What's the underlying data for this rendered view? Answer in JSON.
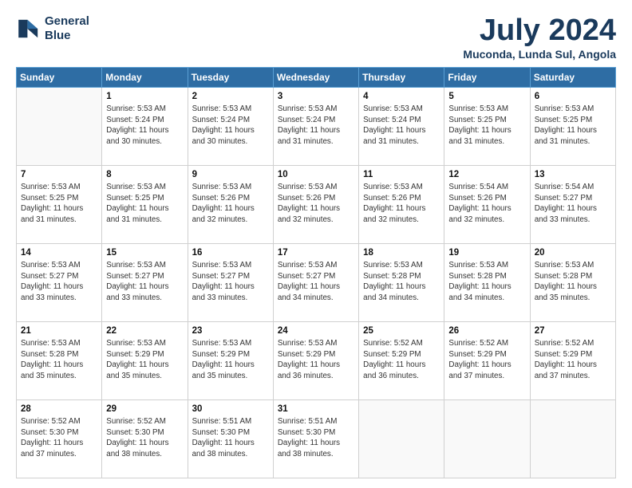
{
  "header": {
    "logo_line1": "General",
    "logo_line2": "Blue",
    "month_title": "July 2024",
    "location": "Muconda, Lunda Sul, Angola"
  },
  "weekdays": [
    "Sunday",
    "Monday",
    "Tuesday",
    "Wednesday",
    "Thursday",
    "Friday",
    "Saturday"
  ],
  "weeks": [
    [
      {
        "day": "",
        "info": ""
      },
      {
        "day": "1",
        "info": "Sunrise: 5:53 AM\nSunset: 5:24 PM\nDaylight: 11 hours\nand 30 minutes."
      },
      {
        "day": "2",
        "info": "Sunrise: 5:53 AM\nSunset: 5:24 PM\nDaylight: 11 hours\nand 30 minutes."
      },
      {
        "day": "3",
        "info": "Sunrise: 5:53 AM\nSunset: 5:24 PM\nDaylight: 11 hours\nand 31 minutes."
      },
      {
        "day": "4",
        "info": "Sunrise: 5:53 AM\nSunset: 5:24 PM\nDaylight: 11 hours\nand 31 minutes."
      },
      {
        "day": "5",
        "info": "Sunrise: 5:53 AM\nSunset: 5:25 PM\nDaylight: 11 hours\nand 31 minutes."
      },
      {
        "day": "6",
        "info": "Sunrise: 5:53 AM\nSunset: 5:25 PM\nDaylight: 11 hours\nand 31 minutes."
      }
    ],
    [
      {
        "day": "7",
        "info": "Sunrise: 5:53 AM\nSunset: 5:25 PM\nDaylight: 11 hours\nand 31 minutes."
      },
      {
        "day": "8",
        "info": "Sunrise: 5:53 AM\nSunset: 5:25 PM\nDaylight: 11 hours\nand 31 minutes."
      },
      {
        "day": "9",
        "info": "Sunrise: 5:53 AM\nSunset: 5:26 PM\nDaylight: 11 hours\nand 32 minutes."
      },
      {
        "day": "10",
        "info": "Sunrise: 5:53 AM\nSunset: 5:26 PM\nDaylight: 11 hours\nand 32 minutes."
      },
      {
        "day": "11",
        "info": "Sunrise: 5:53 AM\nSunset: 5:26 PM\nDaylight: 11 hours\nand 32 minutes."
      },
      {
        "day": "12",
        "info": "Sunrise: 5:54 AM\nSunset: 5:26 PM\nDaylight: 11 hours\nand 32 minutes."
      },
      {
        "day": "13",
        "info": "Sunrise: 5:54 AM\nSunset: 5:27 PM\nDaylight: 11 hours\nand 33 minutes."
      }
    ],
    [
      {
        "day": "14",
        "info": "Sunrise: 5:53 AM\nSunset: 5:27 PM\nDaylight: 11 hours\nand 33 minutes."
      },
      {
        "day": "15",
        "info": "Sunrise: 5:53 AM\nSunset: 5:27 PM\nDaylight: 11 hours\nand 33 minutes."
      },
      {
        "day": "16",
        "info": "Sunrise: 5:53 AM\nSunset: 5:27 PM\nDaylight: 11 hours\nand 33 minutes."
      },
      {
        "day": "17",
        "info": "Sunrise: 5:53 AM\nSunset: 5:27 PM\nDaylight: 11 hours\nand 34 minutes."
      },
      {
        "day": "18",
        "info": "Sunrise: 5:53 AM\nSunset: 5:28 PM\nDaylight: 11 hours\nand 34 minutes."
      },
      {
        "day": "19",
        "info": "Sunrise: 5:53 AM\nSunset: 5:28 PM\nDaylight: 11 hours\nand 34 minutes."
      },
      {
        "day": "20",
        "info": "Sunrise: 5:53 AM\nSunset: 5:28 PM\nDaylight: 11 hours\nand 35 minutes."
      }
    ],
    [
      {
        "day": "21",
        "info": "Sunrise: 5:53 AM\nSunset: 5:28 PM\nDaylight: 11 hours\nand 35 minutes."
      },
      {
        "day": "22",
        "info": "Sunrise: 5:53 AM\nSunset: 5:29 PM\nDaylight: 11 hours\nand 35 minutes."
      },
      {
        "day": "23",
        "info": "Sunrise: 5:53 AM\nSunset: 5:29 PM\nDaylight: 11 hours\nand 35 minutes."
      },
      {
        "day": "24",
        "info": "Sunrise: 5:53 AM\nSunset: 5:29 PM\nDaylight: 11 hours\nand 36 minutes."
      },
      {
        "day": "25",
        "info": "Sunrise: 5:52 AM\nSunset: 5:29 PM\nDaylight: 11 hours\nand 36 minutes."
      },
      {
        "day": "26",
        "info": "Sunrise: 5:52 AM\nSunset: 5:29 PM\nDaylight: 11 hours\nand 37 minutes."
      },
      {
        "day": "27",
        "info": "Sunrise: 5:52 AM\nSunset: 5:29 PM\nDaylight: 11 hours\nand 37 minutes."
      }
    ],
    [
      {
        "day": "28",
        "info": "Sunrise: 5:52 AM\nSunset: 5:30 PM\nDaylight: 11 hours\nand 37 minutes."
      },
      {
        "day": "29",
        "info": "Sunrise: 5:52 AM\nSunset: 5:30 PM\nDaylight: 11 hours\nand 38 minutes."
      },
      {
        "day": "30",
        "info": "Sunrise: 5:51 AM\nSunset: 5:30 PM\nDaylight: 11 hours\nand 38 minutes."
      },
      {
        "day": "31",
        "info": "Sunrise: 5:51 AM\nSunset: 5:30 PM\nDaylight: 11 hours\nand 38 minutes."
      },
      {
        "day": "",
        "info": ""
      },
      {
        "day": "",
        "info": ""
      },
      {
        "day": "",
        "info": ""
      }
    ]
  ]
}
